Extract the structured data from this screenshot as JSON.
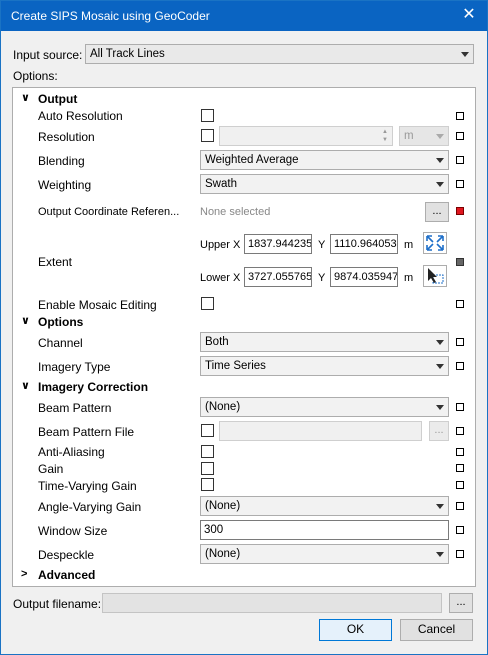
{
  "window": {
    "title": "Create SIPS Mosaic using GeoCoder",
    "close_glyph": "✕"
  },
  "input_source": {
    "label": "Input source:",
    "value": "All Track Lines"
  },
  "options_label": "Options:",
  "sections": {
    "output": "Output",
    "options": "Options",
    "imagery_correction": "Imagery Correction",
    "advanced": "Advanced"
  },
  "chevrons": {
    "expanded": "∨",
    "collapsed": ">"
  },
  "output": {
    "auto_resolution": "Auto Resolution",
    "resolution": "Resolution",
    "resolution_unit": "m",
    "blending": "Blending",
    "blending_value": "Weighted Average",
    "weighting": "Weighting",
    "weighting_value": "Swath",
    "ocr_label": "Output Coordinate Referen...",
    "ocr_value": "None selected",
    "ocr_button": "...",
    "extent": "Extent",
    "upper_x_label": "Upper X",
    "upper_x": "1837.944235",
    "upper_y_label": "Y",
    "upper_y": "1110.964053",
    "upper_unit": "m",
    "lower_x_label": "Lower X",
    "lower_x": "3727.055765",
    "lower_y_label": "Y",
    "lower_y": "9874.035947",
    "lower_unit": "m",
    "enable_mosaic_editing": "Enable Mosaic Editing"
  },
  "options": {
    "channel": "Channel",
    "channel_value": "Both",
    "imagery_type": "Imagery Type",
    "imagery_type_value": "Time Series"
  },
  "correction": {
    "beam_pattern": "Beam Pattern",
    "beam_pattern_value": "(None)",
    "beam_pattern_file": "Beam Pattern File",
    "beam_pattern_file_button": "...",
    "anti_aliasing": "Anti-Aliasing",
    "gain": "Gain",
    "time_varying_gain": "Time-Varying Gain",
    "angle_varying_gain": "Angle-Varying Gain",
    "angle_varying_gain_value": "(None)",
    "window_size": "Window Size",
    "window_size_value": "300",
    "despeckle": "Despeckle",
    "despeckle_value": "(None)"
  },
  "footer": {
    "output_filename_label": "Output filename:",
    "browse_button": "...",
    "ok": "OK",
    "cancel": "Cancel"
  },
  "colors": {
    "title_bar": "#0a64c2",
    "error_flag": "#e0161f",
    "focus_border": "#0078d7"
  }
}
